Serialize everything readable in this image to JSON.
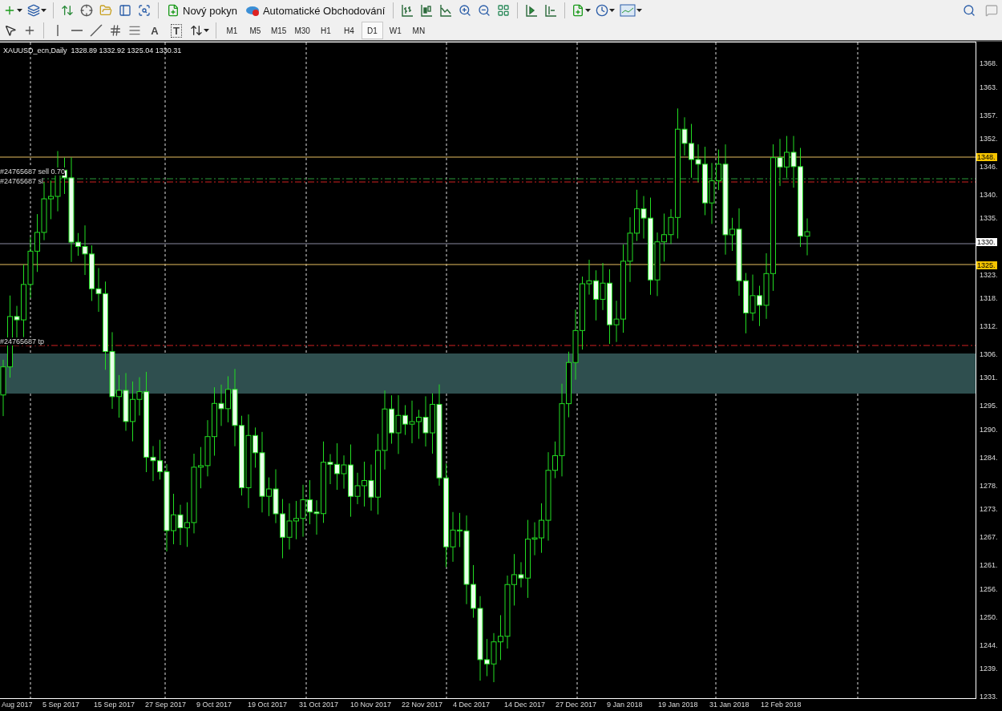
{
  "toolbar": {
    "buttons": [
      {
        "label": "Nový pokyn"
      },
      {
        "label": "Automatické Obchodování"
      }
    ]
  },
  "drawing_toolbar": {
    "tools": [
      {
        "kind": "text",
        "label": "A"
      },
      {
        "kind": "label",
        "label": "T"
      }
    ],
    "timeframes": [
      {
        "label": "M1",
        "selected": false
      },
      {
        "label": "M5",
        "selected": false
      },
      {
        "label": "M15",
        "selected": false
      },
      {
        "label": "M30",
        "selected": false
      },
      {
        "label": "H1",
        "selected": false
      },
      {
        "label": "H4",
        "selected": false
      },
      {
        "label": "D1",
        "selected": true
      },
      {
        "label": "W1",
        "selected": false
      },
      {
        "label": "MN",
        "selected": false
      }
    ]
  },
  "chart": {
    "symbol": "XAUUSD_ecn,Daily",
    "ohlc": "1328.89 1332.92 1325.04 1330.31",
    "order_labels": [
      "#24765687 sell 0.70",
      "#24765687 sl",
      "#24765687 tp"
    ],
    "price_axis": {
      "ticks": [
        "1368.",
        "1363.",
        "1357.",
        "1352.",
        "1346.",
        "1340.",
        "1335.",
        "1323.",
        "1318.",
        "1312.",
        "1306.",
        "1301.",
        "1295.",
        "1290.",
        "1284.",
        "1278.",
        "1273.",
        "1267.",
        "1261.",
        "1256.",
        "1250.",
        "1244.",
        "1239.",
        "1233."
      ],
      "tags": [
        {
          "text": "1348.",
          "kind": "level"
        },
        {
          "text": "1330.",
          "kind": "price"
        },
        {
          "text": "1325.",
          "kind": "level"
        }
      ]
    },
    "date_axis": [
      "Aug 2017",
      "5 Sep 2017",
      "15 Sep 2017",
      "27 Sep 2017",
      "9 Oct 2017",
      "19 Oct 2017",
      "31 Oct 2017",
      "10 Nov 2017",
      "22 Nov 2017",
      "4 Dec 2017",
      "14 Dec 2017",
      "27 Dec 2017",
      "9 Jan 2018",
      "19 Jan 2018",
      "31 Jan 2018",
      "12 Feb 2018"
    ]
  }
}
